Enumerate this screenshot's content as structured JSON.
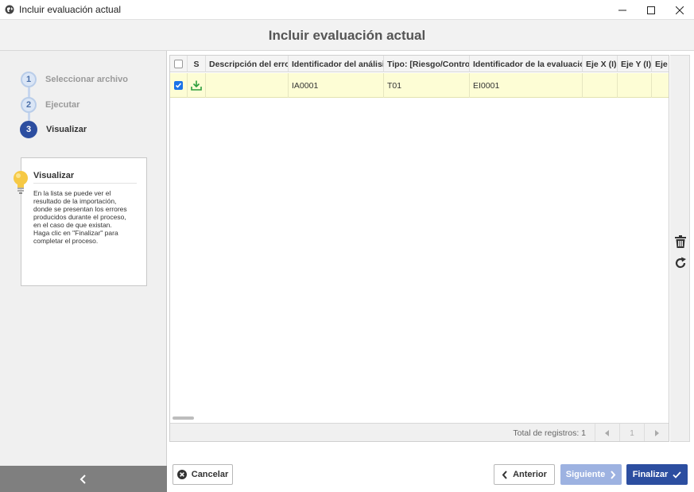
{
  "window": {
    "title": "Incluir evaluación actual"
  },
  "header": {
    "title": "Incluir evaluación actual"
  },
  "wizard": {
    "steps": [
      {
        "number": "1",
        "label": "Seleccionar archivo",
        "state": "done"
      },
      {
        "number": "2",
        "label": "Ejecutar",
        "state": "done"
      },
      {
        "number": "3",
        "label": "Visualizar",
        "state": "active"
      }
    ]
  },
  "help": {
    "title": "Visualizar",
    "text": "En la lista se puede ver el\nresultado de la importación,\ndonde se presentan los errores\nproducidos durante el proceso,\nen el caso de que existan.\nHaga clic en \"Finalizar\" para\ncompletar el proceso."
  },
  "grid": {
    "columns": [
      "",
      "S",
      "Descripción del error",
      "Identificador del análisis",
      "Tipo: [Riesgo/Control]",
      "Identificador de la evaluación",
      "Eje X (I)",
      "Eje Y (I)",
      "Eje X"
    ],
    "rows": [
      {
        "checked": true,
        "status_icon": "download-icon",
        "error": "",
        "analysis_id": "IA0001",
        "type": "T01",
        "evaluation_id": "EI0001",
        "x_axis": "",
        "y_axis": "",
        "x_axis_2": ""
      }
    ],
    "footer": {
      "total_label": "Total de registros: 1",
      "page": "1"
    }
  },
  "buttons": {
    "cancel": "Cancelar",
    "previous": "Anterior",
    "next": "Siguiente",
    "finish": "Finalizar"
  },
  "colors": {
    "accent": "#2c4ea0",
    "row_highlight": "#fdfdd5",
    "status_green": "#2e9e3e",
    "disabled_next": "#9db2e1"
  }
}
